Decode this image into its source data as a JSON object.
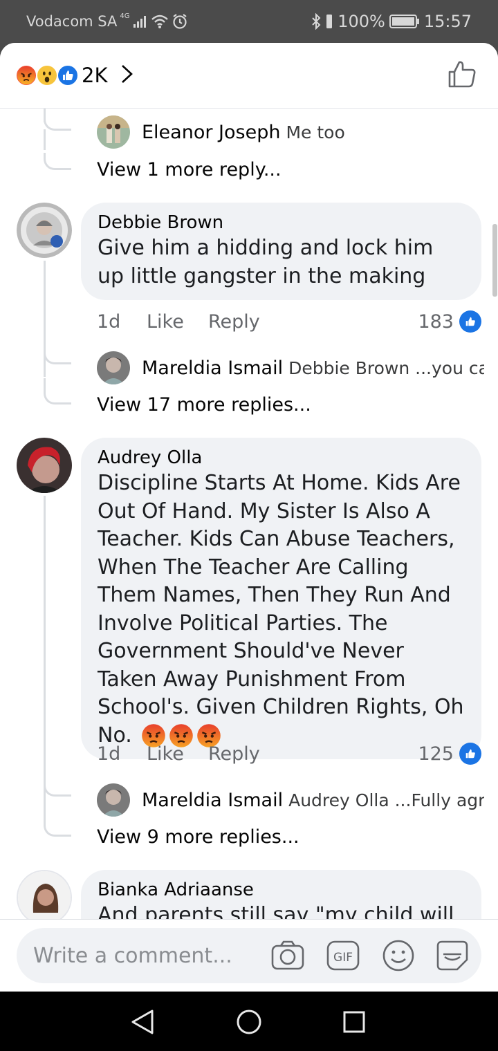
{
  "status_bar": {
    "carrier": "Vodacom SA",
    "network": "4G",
    "battery": "100%",
    "time": "15:57"
  },
  "header": {
    "reaction_icons": [
      "angry-reaction",
      "wow-reaction",
      "like-reaction"
    ],
    "reaction_count": "2K"
  },
  "comments": [
    {
      "replies_preview": {
        "author": "Eleanor Joseph",
        "text": "Me too"
      },
      "view_more": "View 1 more reply..."
    },
    {
      "author": "Debbie Brown",
      "text": "Give him a hidding and lock him up little gangster in the making",
      "time": "1d",
      "like_label": "Like",
      "reply_label": "Reply",
      "like_count": "183",
      "replies_preview": {
        "author": "Mareldia Ismail",
        "text": "Debbie Brown ...you can..."
      },
      "view_more": "View 17 more replies..."
    },
    {
      "author": "Audrey Olla",
      "text": "Discipline Starts At Home. Kids Are Out Of Hand. My Sister Is Also A Teacher. Kids Can Abuse Teachers, When The Teacher Are Calling Them Names, Then They Run And Involve Political Parties. The Government Should've Never Taken Away Punishment From School's. Given Children Rights, Oh No.",
      "trailing_emojis": [
        "angry-face",
        "angry-face",
        "angry-face"
      ],
      "time": "1d",
      "like_label": "Like",
      "reply_label": "Reply",
      "like_count": "125",
      "replies_preview": {
        "author": "Mareldia Ismail",
        "text": "Audrey Olla ...Fully agree."
      },
      "view_more": "View 9 more replies..."
    },
    {
      "author": "Bianka Adriaanse",
      "text": "And parents still say \"my child will"
    }
  ],
  "composer": {
    "placeholder": "Write a comment...",
    "icons": [
      "camera-icon",
      "gif-icon",
      "emoji-icon",
      "sticker-icon"
    ]
  },
  "colors": {
    "like_blue": "#1b74e4",
    "bubble": "#f0f2f5",
    "secondary_text": "#65676b",
    "thread_line": "#dadde1"
  }
}
